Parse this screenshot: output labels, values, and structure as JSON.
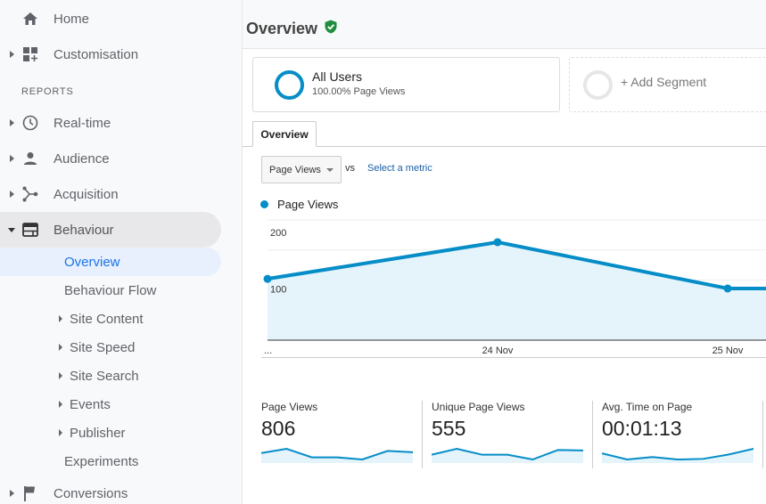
{
  "sidebar": {
    "top_items": [
      {
        "label": "Home",
        "icon": "home-icon"
      },
      {
        "label": "Customisation",
        "icon": "dashboard-add-icon"
      }
    ],
    "section_title": "REPORTS",
    "report_items": [
      {
        "label": "Real-time",
        "icon": "clock-icon"
      },
      {
        "label": "Audience",
        "icon": "person-icon"
      },
      {
        "label": "Acquisition",
        "icon": "acquisition-icon"
      },
      {
        "label": "Behaviour",
        "icon": "behaviour-icon"
      }
    ],
    "behaviour_sub": [
      {
        "label": "Overview"
      },
      {
        "label": "Behaviour Flow"
      },
      {
        "label": "Site Content"
      },
      {
        "label": "Site Speed"
      },
      {
        "label": "Site Search"
      },
      {
        "label": "Events"
      },
      {
        "label": "Publisher"
      },
      {
        "label": "Experiments"
      }
    ],
    "bottom_items": [
      {
        "label": "Conversions",
        "icon": "flag-icon"
      }
    ]
  },
  "header": {
    "title": "Overview",
    "verified_icon": "shield-check-icon"
  },
  "segments": {
    "active": {
      "title": "All Users",
      "subtitle": "100.00% Page Views"
    },
    "add_label": "+ Add Segment"
  },
  "tabs": [
    {
      "label": "Overview"
    }
  ],
  "metric_picker": {
    "selected": "Page Views",
    "vs_label": "vs",
    "select_metric_label": "Select a metric"
  },
  "colors": {
    "accent": "#058dc7",
    "area_fill": "#e5f3fa",
    "nav_selected_bg": "#e8f0fe",
    "nav_selected_text": "#1a73e8",
    "verified_green": "#1e8e3e"
  },
  "chart_data": {
    "type": "area",
    "series": [
      {
        "name": "Page Views",
        "values": [
          102,
          163,
          86,
          86
        ]
      }
    ],
    "x": [
      "...",
      "24 Nov",
      "25 Nov",
      ""
    ],
    "xtick_labels": [
      "...",
      "24 Nov",
      "25 Nov"
    ],
    "ytick_labels": [
      "200",
      "100"
    ],
    "yticks": [
      200,
      100
    ],
    "ylim": [
      0,
      200
    ],
    "legend": "top-left",
    "grid": true,
    "title": "",
    "xlabel": "",
    "ylabel": ""
  },
  "scorecards": [
    {
      "label": "Page Views",
      "value": "806",
      "spark": [
        3,
        5,
        1,
        1,
        0,
        4,
        3.4
      ]
    },
    {
      "label": "Unique Page Views",
      "value": "555",
      "spark": [
        2,
        4.5,
        2,
        2,
        0,
        4,
        3.8
      ]
    },
    {
      "label": "Avg. Time on Page",
      "value": "00:01:13",
      "spark": [
        3,
        1,
        1.8,
        1,
        1.2,
        2.6,
        4.5
      ]
    }
  ]
}
